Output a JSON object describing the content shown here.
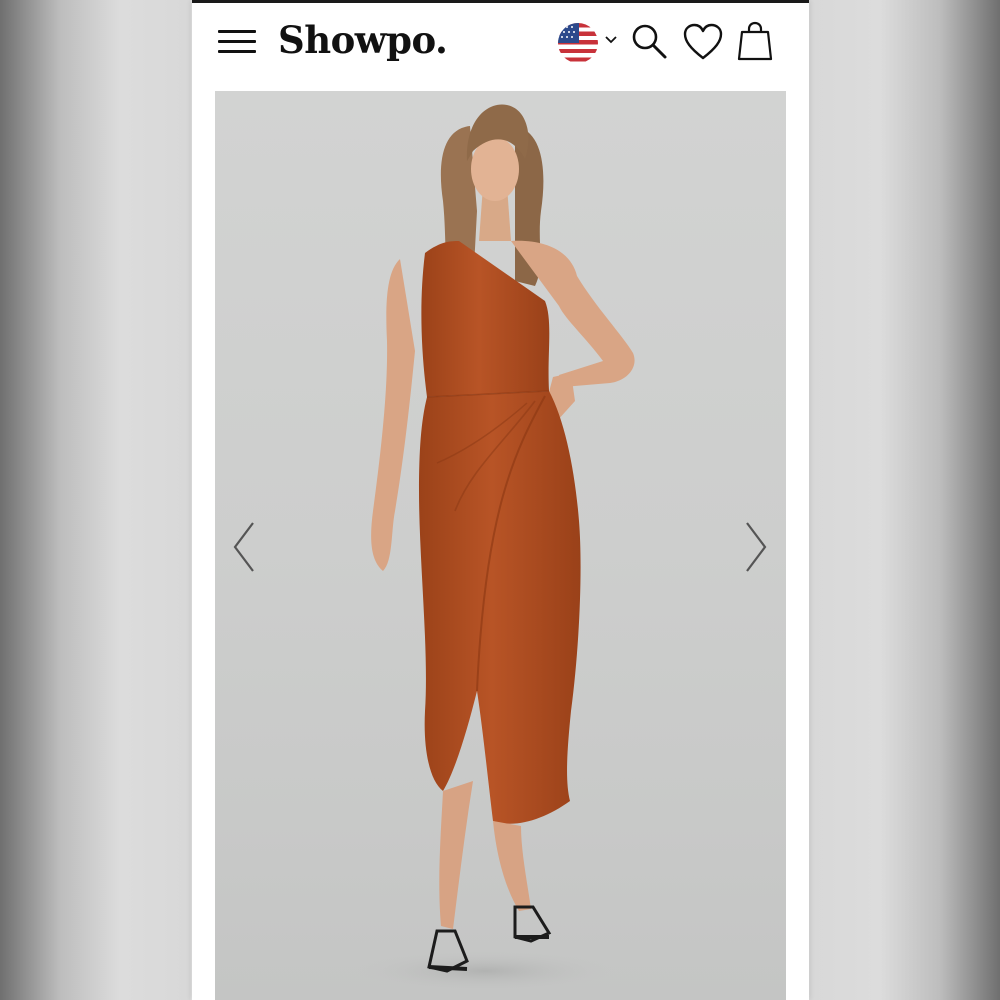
{
  "header": {
    "logo_text": "Showpo.",
    "menu_icon": "hamburger-menu-icon",
    "region_flag_icon": "us-flag-icon",
    "region_dropdown_icon": "chevron-down-icon",
    "search_icon": "search-icon",
    "wishlist_icon": "heart-icon",
    "bag_icon": "shopping-bag-icon"
  },
  "product_gallery": {
    "image_subject": "model-in-rust-one-shoulder-midi-dress",
    "prev_icon": "chevron-left-icon",
    "next_icon": "chevron-right-icon"
  },
  "colors": {
    "dress": "#b04f22",
    "backdrop": "#cfd0cf",
    "text": "#111111"
  }
}
